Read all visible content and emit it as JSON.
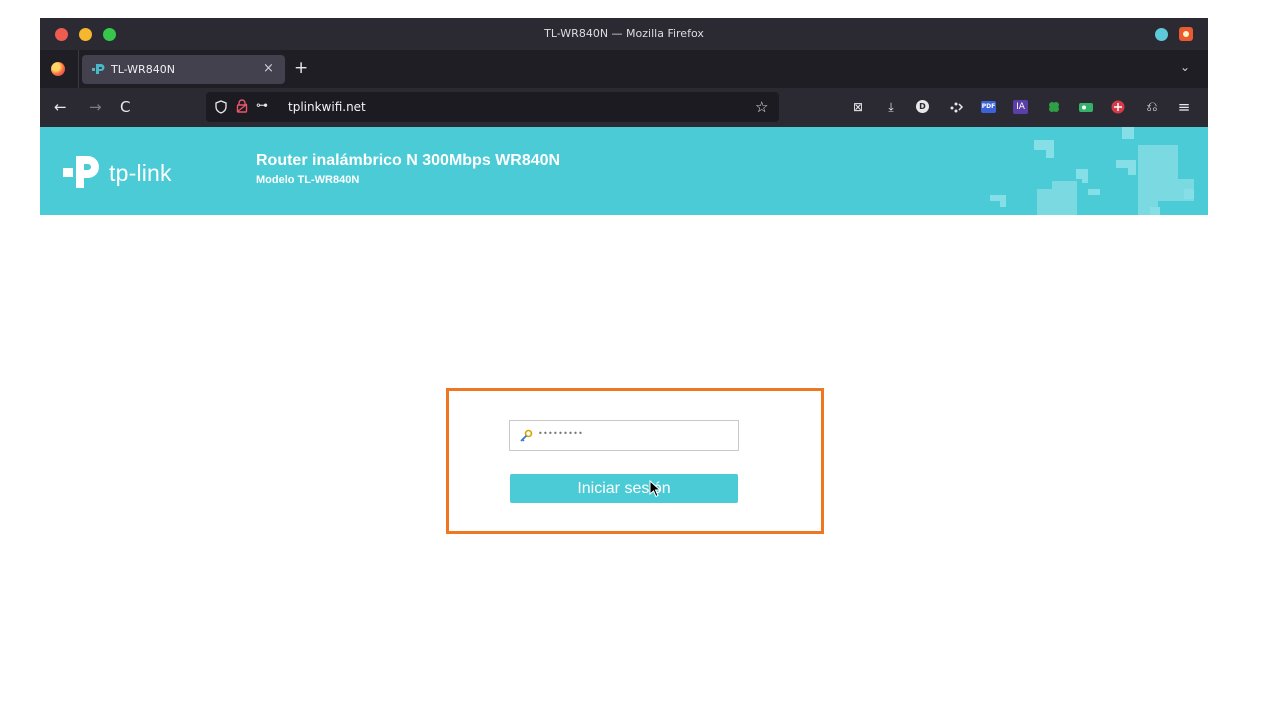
{
  "browser": {
    "window_title": "TL-WR840N — Mozilla Firefox",
    "tab_title": "TL-WR840N",
    "tab_close": "×",
    "new_tab": "+",
    "tabs_list": "⌄",
    "url": "tplinkwifi.net",
    "nav": {
      "back": "←",
      "forward": "→",
      "reload": "C"
    },
    "bookmark_star": "☆",
    "url_key_icon": "⊶",
    "toolbar": {
      "pocket": "⊠",
      "downloads": "⤓",
      "ext_d": "D",
      "ext_pdf": "PDF",
      "ext_ia": "IA",
      "share": "⎌",
      "menu": "≡"
    }
  },
  "header": {
    "logo_text": "tp-link",
    "title": "Router inalámbrico N 300Mbps WR840N",
    "model": "Modelo TL-WR840N"
  },
  "login": {
    "password_value": "•••••••••",
    "button_label": "Iniciar sesión",
    "highlight_color": "#f07722"
  },
  "colors": {
    "brand": "#4acbd6",
    "browser_chrome": "#2b2a33"
  }
}
